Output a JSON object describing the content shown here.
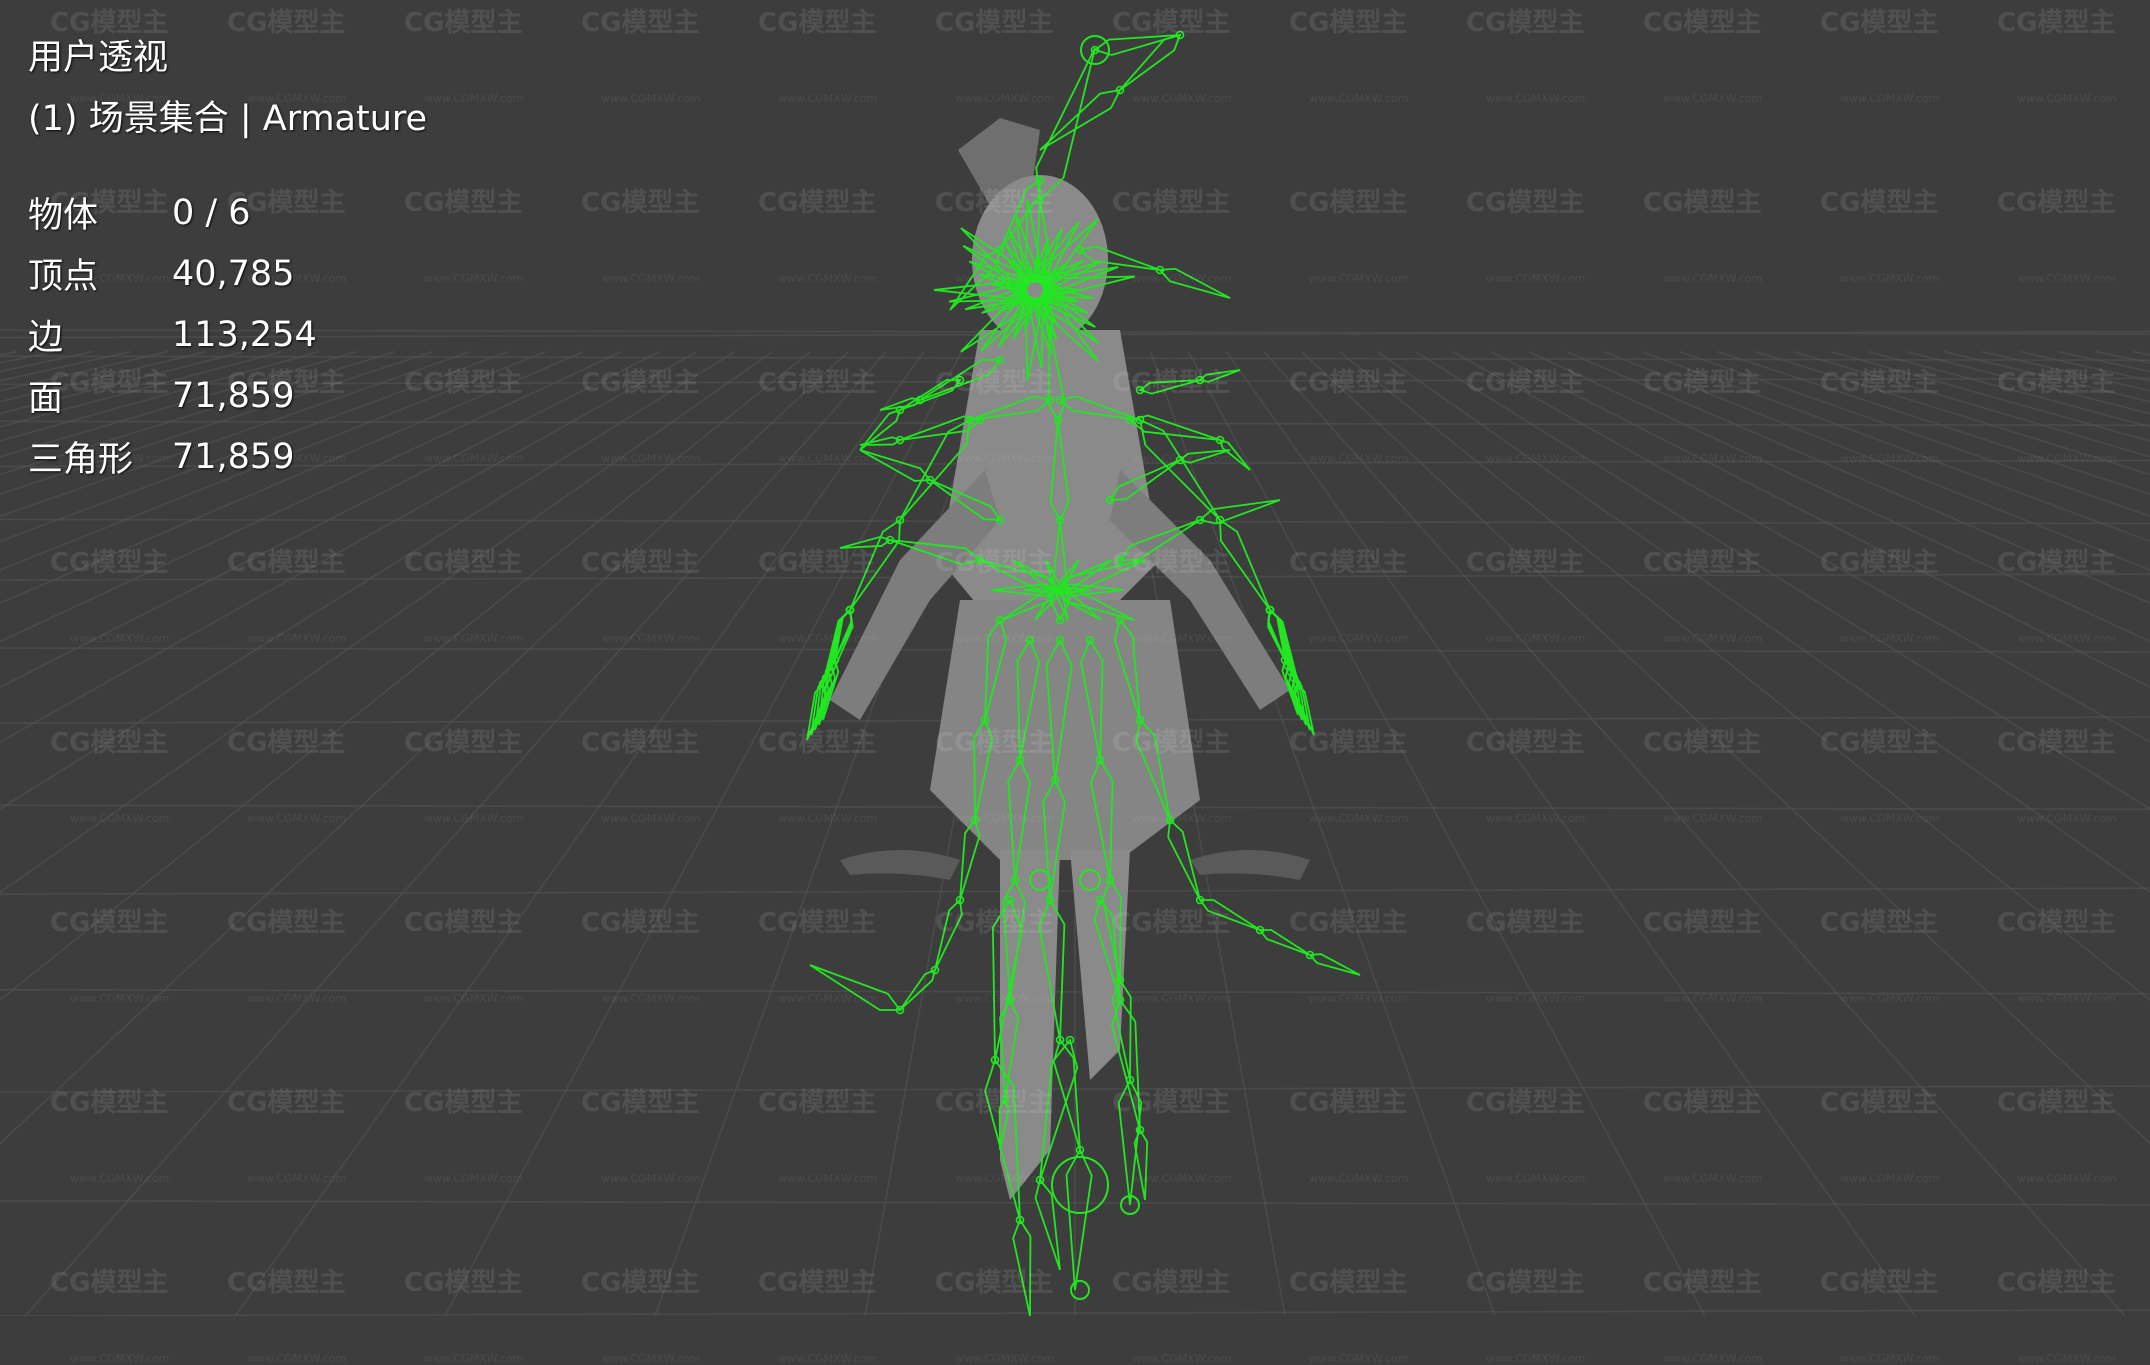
{
  "viewport": {
    "view_name": "用户透视",
    "collection_label": "(1) 场景集合 | Armature",
    "stats": [
      {
        "label": "物体",
        "value": "0 / 6"
      },
      {
        "label": "顶点",
        "value": "40,785"
      },
      {
        "label": "边",
        "value": "113,254"
      },
      {
        "label": "面",
        "value": "71,859"
      },
      {
        "label": "三角形",
        "value": "71,859"
      }
    ]
  },
  "watermark": {
    "logo_text": "CG模型主",
    "url_text": "www.CGMXW.com"
  },
  "colors": {
    "background": "#3d3d3d",
    "grid_line": "#555555",
    "armature_bone": "#22e622",
    "mesh": "#8a8a8a",
    "overlay_text": "#ffffff"
  }
}
